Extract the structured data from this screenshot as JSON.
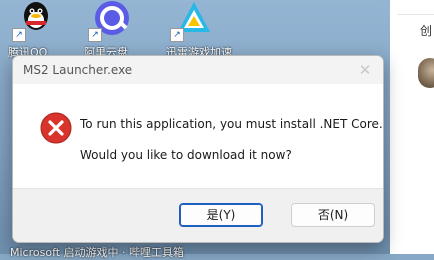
{
  "desktop": {
    "icons": [
      {
        "label": "腾讯QQ",
        "name": "qq-icon"
      },
      {
        "label": "阿里云盘",
        "name": "aliyun-drive-icon"
      },
      {
        "label": "迅雷游戏加速",
        "name": "game-accelerator-icon"
      }
    ],
    "bottom_row": "Microsoft    启动游戏中 · 哔哩工具箱"
  },
  "right_panel": {
    "text": "创"
  },
  "dialog": {
    "title": "MS2 Launcher.exe",
    "close_glyph": "✕",
    "message_line1": "To run this application, you must install .NET Core.",
    "message_line2": "Would you like to download it now?",
    "yes_label": "是(Y)",
    "no_label": "否(N)",
    "icon": "error-icon",
    "colors": {
      "error_red": "#d9342b",
      "focus_blue": "#1f5fbf"
    }
  }
}
